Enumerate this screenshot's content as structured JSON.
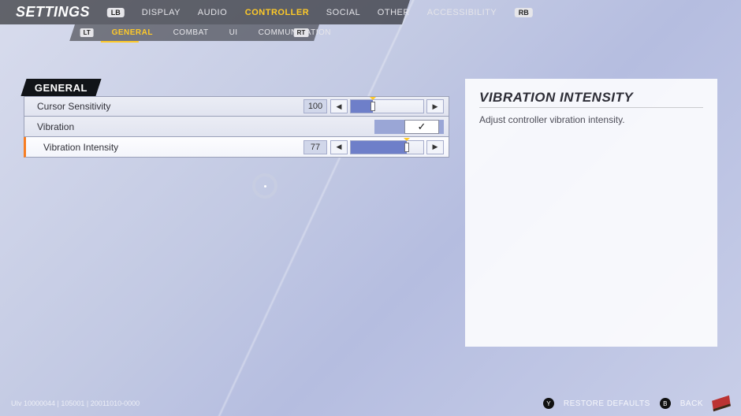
{
  "header": {
    "title": "SETTINGS",
    "lb": "LB",
    "rb": "RB",
    "tabs": [
      "DISPLAY",
      "AUDIO",
      "CONTROLLER",
      "SOCIAL",
      "OTHER",
      "ACCESSIBILITY"
    ],
    "active_tab": 2
  },
  "subheader": {
    "lt": "LT",
    "rt": "RT",
    "tabs": [
      "GENERAL",
      "COMBAT",
      "UI",
      "COMMUNICATION"
    ],
    "active_tab": 0
  },
  "section": {
    "title": "GENERAL"
  },
  "rows": {
    "cursor_sensitivity": {
      "label": "Cursor Sensitivity",
      "value": "100",
      "min": 0,
      "max": 100,
      "pct": 30,
      "tickpct": 30
    },
    "vibration": {
      "label": "Vibration",
      "checked": true,
      "checkmark": "✓"
    },
    "vibration_intensity": {
      "label": "Vibration Intensity",
      "value": "77",
      "min": 0,
      "max": 100,
      "pct": 77,
      "tickpct": 77
    }
  },
  "info": {
    "title": "VIBRATION INTENSITY",
    "description": "Adjust controller vibration intensity."
  },
  "footer": {
    "build": "UIv 10000044 | 105001 | 20011010-0000",
    "y": "Y",
    "y_label": "RESTORE DEFAULTS",
    "b": "B",
    "b_label": "BACK"
  }
}
